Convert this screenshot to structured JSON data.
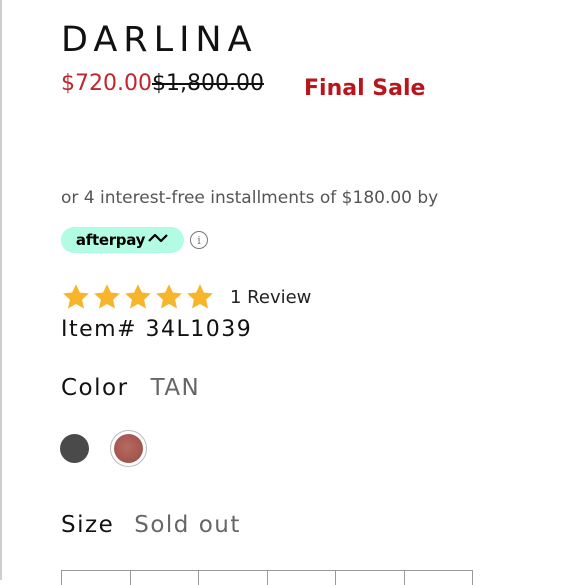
{
  "product": {
    "title": "DARLINA",
    "sale_price": "$720.00",
    "original_price": "$1,800.00",
    "final_sale_label": "Final Sale",
    "installment_text": "or 4 interest-free installments of $180.00 by",
    "afterpay_label": "afterpay",
    "rating_stars": 5,
    "review_count_text": "1 Review",
    "item_number_text": "Item# 34L1039"
  },
  "color": {
    "label": "Color",
    "selected_value": "TAN",
    "swatches": [
      {
        "name": "dark",
        "hex": "#4a4a4a"
      },
      {
        "name": "tan",
        "hex": "#a5574f",
        "selected": true
      }
    ]
  },
  "size": {
    "label": "Size",
    "status": "Sold out"
  },
  "colors": {
    "sale_red": "#c0262d",
    "final_sale_red": "#b8151c",
    "afterpay_mint": "#b2fce4",
    "star_yellow": "#f7b52c"
  },
  "icons": [
    "afterpay-arrows-icon",
    "info-icon",
    "star-icon"
  ]
}
